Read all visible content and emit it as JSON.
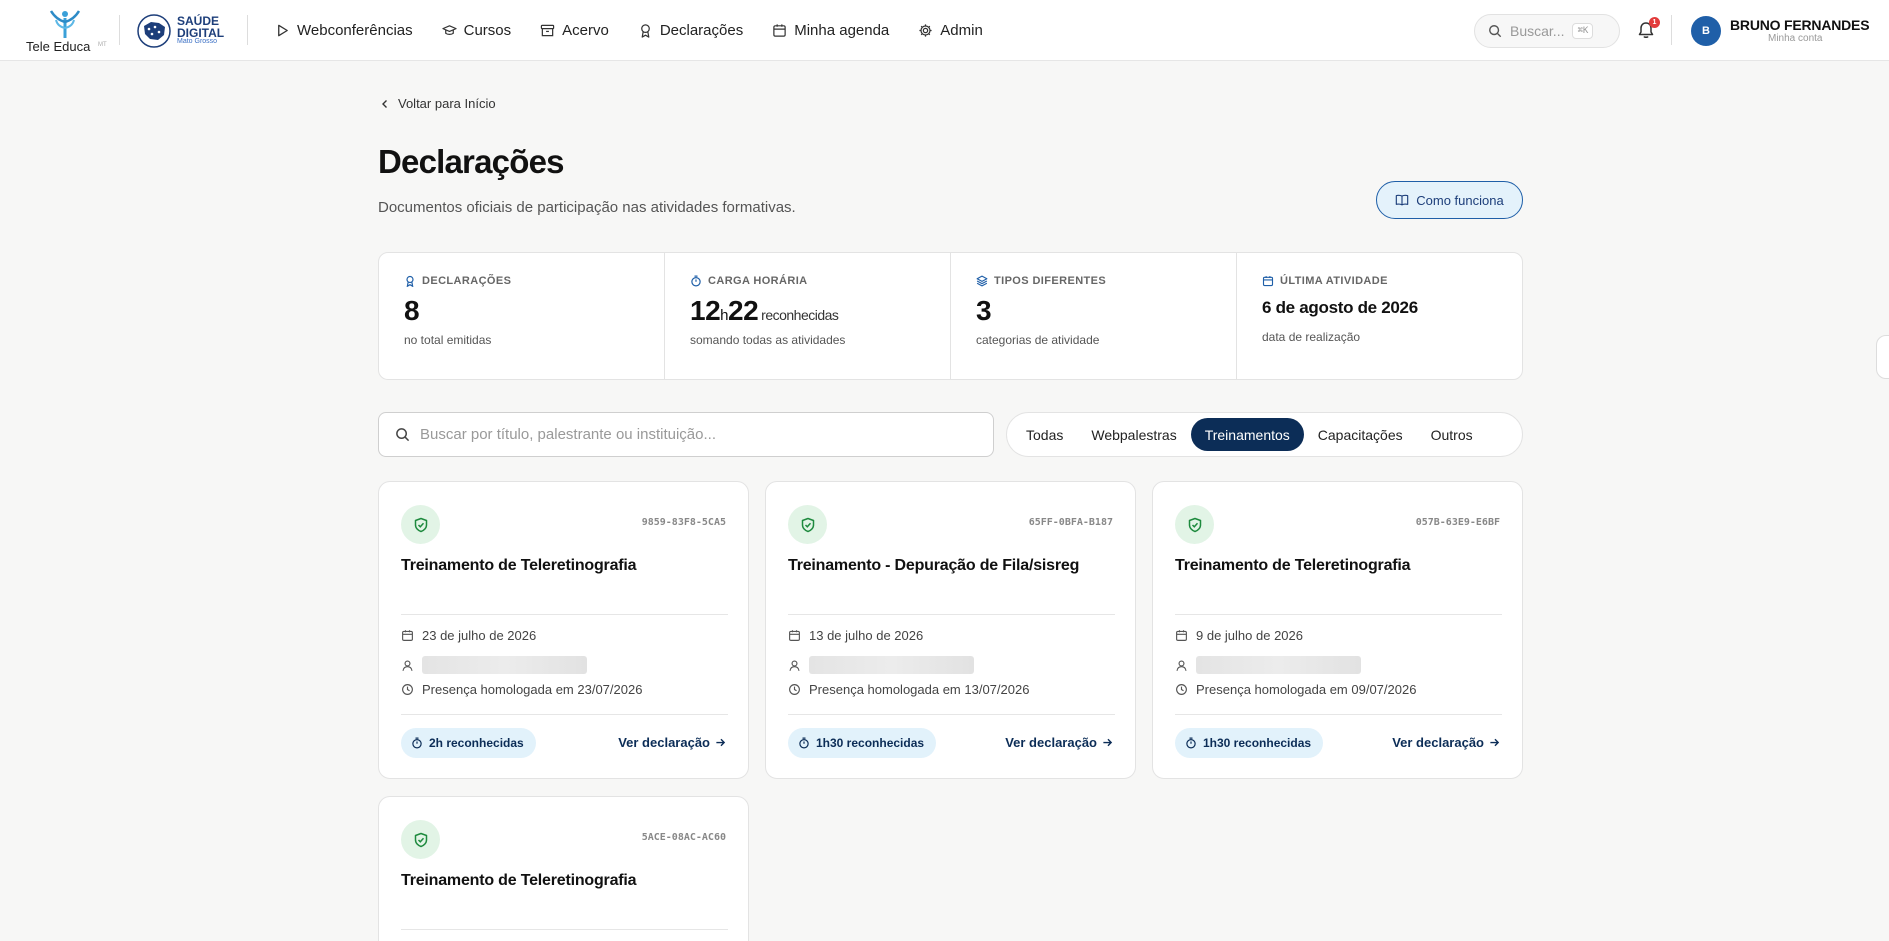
{
  "header": {
    "tele_logo_text": "Tele Educa",
    "tele_logo_sup": "MT",
    "sd_logo_line1": "SAÚDE",
    "sd_logo_line2": "DIGITAL",
    "sd_logo_line3": "Mato Grosso",
    "nav": [
      {
        "label": "Webconferências",
        "icon": "play-icon"
      },
      {
        "label": "Cursos",
        "icon": "graduation-cap-icon"
      },
      {
        "label": "Acervo",
        "icon": "archive-icon"
      },
      {
        "label": "Declarações",
        "icon": "award-icon"
      },
      {
        "label": "Minha agenda",
        "icon": "calendar-icon"
      },
      {
        "label": "Admin",
        "icon": "gear-icon"
      }
    ],
    "search_placeholder": "Buscar...",
    "search_shortcut": "⌘K",
    "notification_count": "1",
    "user_initial": "B",
    "user_name": "BRUNO FERNANDES",
    "user_sub": "Minha conta"
  },
  "page": {
    "back_label": "Voltar para Início",
    "title": "Declarações",
    "subtitle": "Documentos oficiais de participação nas atividades formativas.",
    "how_button": "Como funciona"
  },
  "stats": [
    {
      "label": "DECLARAÇÕES",
      "value": "8",
      "sub": "no total emitidas",
      "icon": "award-icon"
    },
    {
      "label": "CARGA HORÁRIA",
      "value_h": "12",
      "value_h_unit": "h",
      "value_m": "22",
      "suffix": "reconhecidas",
      "sub": "somando todas as atividades",
      "icon": "stopwatch-icon"
    },
    {
      "label": "TIPOS DIFERENTES",
      "value": "3",
      "sub": "categorias de atividade",
      "icon": "layers-icon"
    },
    {
      "label": "ÚLTIMA ATIVIDADE",
      "value": "6 de agosto de 2026",
      "sub": "data de realização",
      "icon": "calendar-icon"
    }
  ],
  "search": {
    "placeholder": "Buscar por título, palestrante ou instituição..."
  },
  "filters": {
    "items": [
      "Todas",
      "Webpalestras",
      "Treinamentos",
      "Capacitações",
      "Outros"
    ],
    "active": "Treinamentos"
  },
  "cards": [
    {
      "code": "9859-83F8-5CA5",
      "title": "Treinamento de Teleretinografia",
      "date": "23 de julho de 2026",
      "presence": "Presença homologada em 23/07/2026",
      "hours": "2h reconhecidas",
      "view": "Ver declaração"
    },
    {
      "code": "65FF-0BFA-B187",
      "title": "Treinamento - Depuração de Fila/sisreg",
      "date": "13 de julho de 2026",
      "presence": "Presença homologada em 13/07/2026",
      "hours": "1h30 reconhecidas",
      "view": "Ver declaração"
    },
    {
      "code": "057B-63E9-E6BF",
      "title": "Treinamento de Teleretinografia",
      "date": "9 de julho de 2026",
      "presence": "Presença homologada em 09/07/2026",
      "hours": "1h30 reconhecidas",
      "view": "Ver declaração"
    },
    {
      "code": "5ACE-08AC-AC60",
      "title": "Treinamento de Teleretinografia"
    }
  ],
  "colors": {
    "primary": "#0c2d57",
    "accent_light": "#e2f2fb",
    "success_bg": "#e2f4e6",
    "success": "#1e8a3e"
  }
}
